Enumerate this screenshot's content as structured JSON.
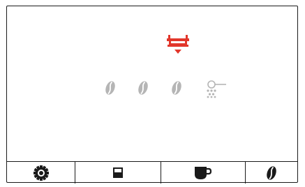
{
  "screen": {
    "alert": {
      "icon": "empty-drip-tray-icon",
      "color": "#e2362b"
    },
    "status_icons": [
      {
        "icon": "coffee-bean-icon",
        "color": "#b5b5b5"
      },
      {
        "icon": "coffee-bean-icon",
        "color": "#b5b5b5"
      },
      {
        "icon": "coffee-bean-icon",
        "color": "#b5b5b5"
      },
      {
        "icon": "ground-coffee-icon",
        "color": "#b5b5b5"
      }
    ]
  },
  "bottom_bar": {
    "buttons": [
      {
        "icon": "gear-icon",
        "label": ""
      },
      {
        "icon": "small-cup-icon",
        "label": ""
      },
      {
        "icon": "large-cup-icon",
        "label": ""
      },
      {
        "icon": "coffee-bean-icon",
        "label": ""
      }
    ]
  },
  "colors": {
    "frame": "#1a1a1a",
    "inactive": "#b5b5b5",
    "alert": "#e2362b",
    "background": "#ffffff"
  }
}
